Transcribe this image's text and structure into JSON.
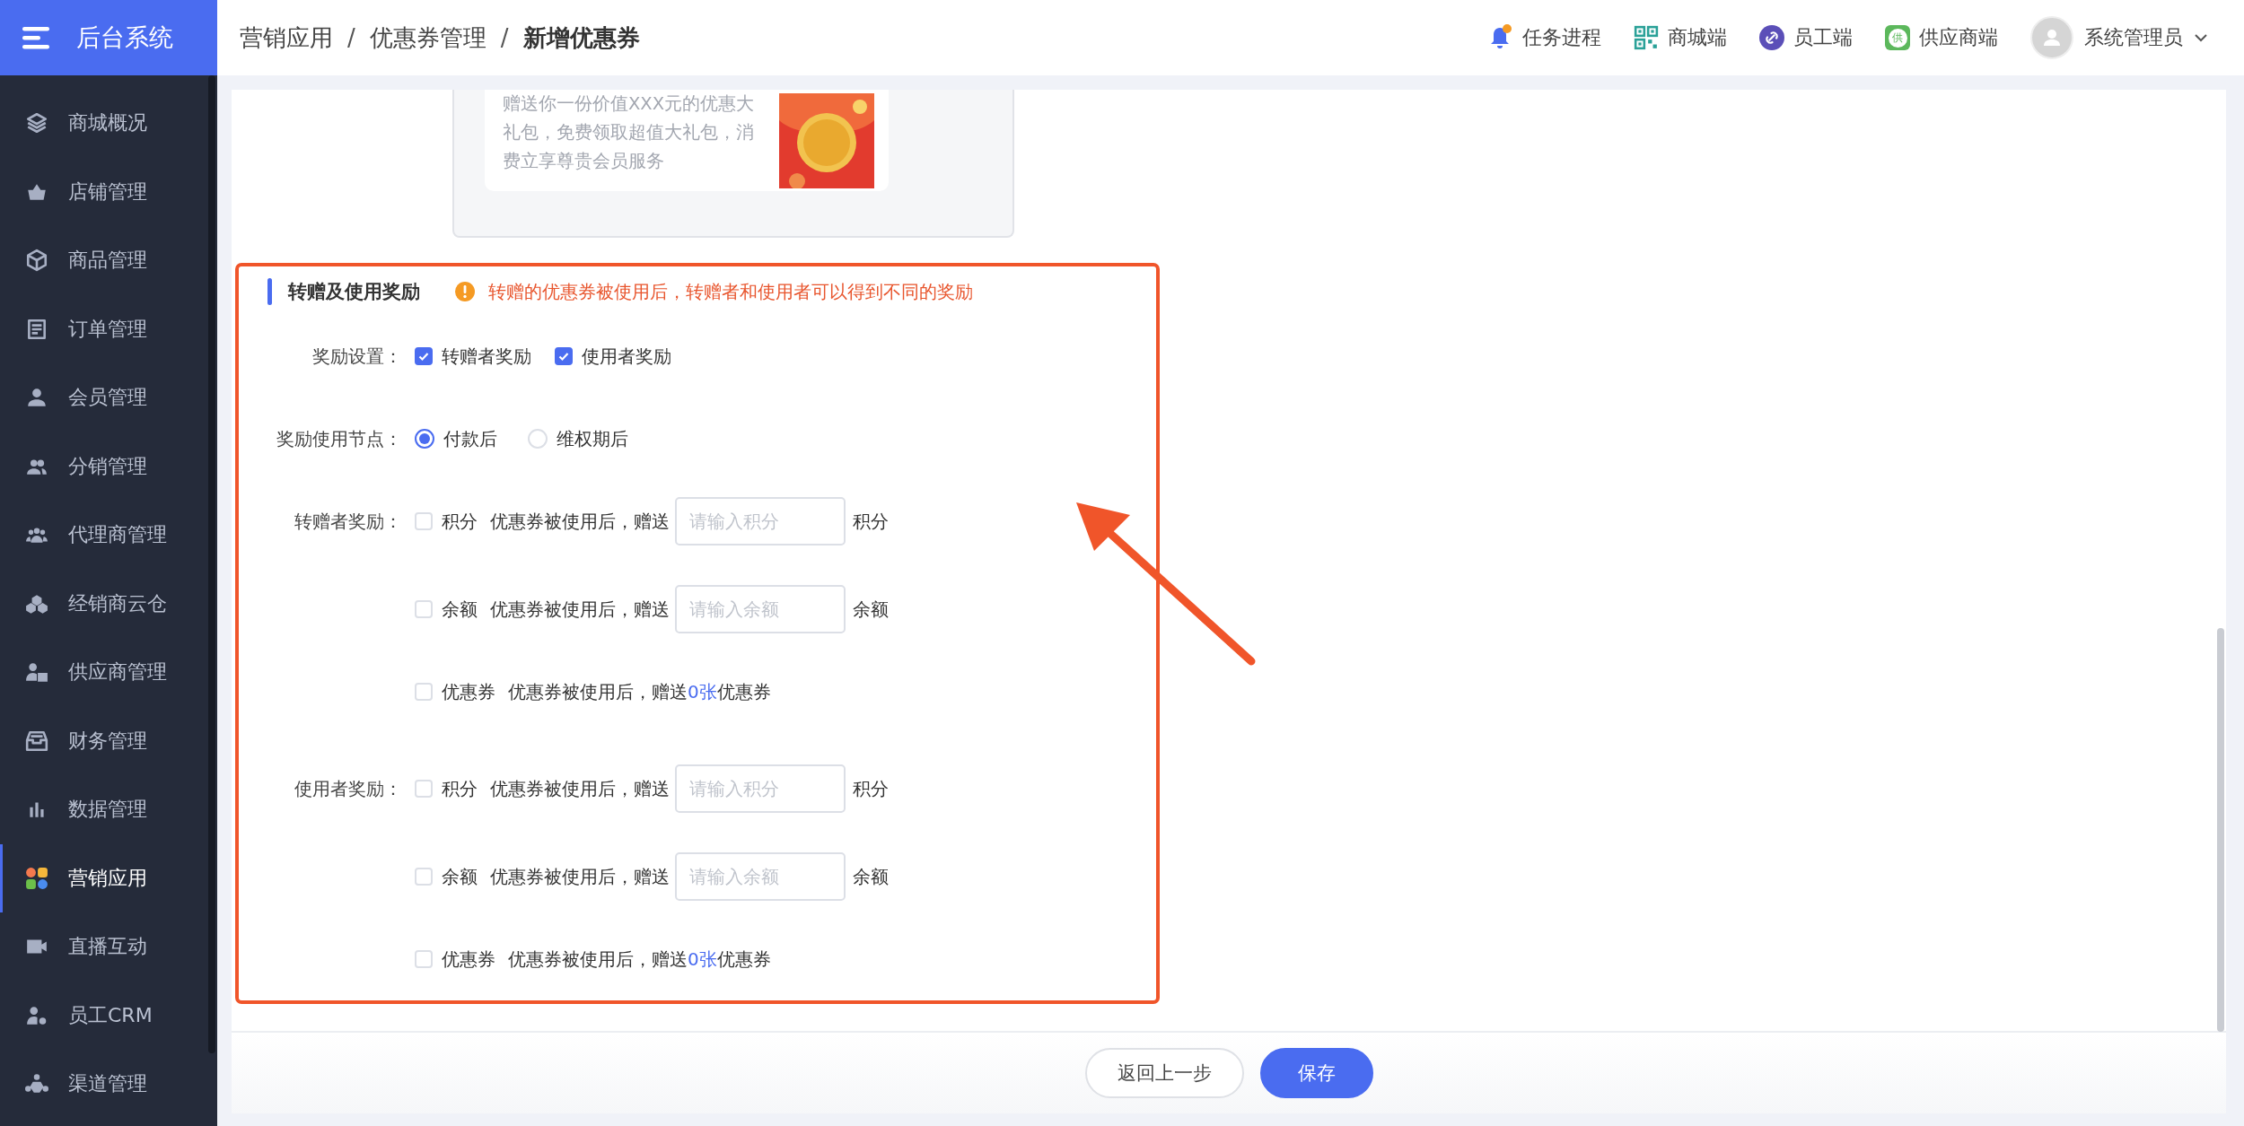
{
  "app": {
    "title": "后台系统"
  },
  "breadcrumb": [
    {
      "label": "营销应用",
      "current": false
    },
    {
      "separator": "/",
      "label": "优惠券管理",
      "current": false
    },
    {
      "separator": "/",
      "label": "新增优惠券",
      "current": true
    }
  ],
  "header_links": [
    {
      "kind": "bell",
      "label": "任务进程",
      "badge": true
    },
    {
      "kind": "qr",
      "label": "商城端"
    },
    {
      "kind": "link",
      "label": "员工端"
    },
    {
      "kind": "supplier",
      "label": "供应商端",
      "icon_text": "供"
    }
  ],
  "user": {
    "name": "系统管理员"
  },
  "sidebar": {
    "items": [
      {
        "kind": "layers",
        "label": "商城概况",
        "selected": false
      },
      {
        "kind": "basket",
        "label": "店铺管理",
        "selected": false
      },
      {
        "kind": "box",
        "label": "商品管理",
        "selected": false
      },
      {
        "kind": "document",
        "label": "订单管理",
        "selected": false
      },
      {
        "kind": "person",
        "label": "会员管理",
        "selected": false
      },
      {
        "kind": "people",
        "label": "分销管理",
        "selected": false
      },
      {
        "kind": "group",
        "label": "代理商管理",
        "selected": false
      },
      {
        "kind": "cubes",
        "label": "经销商云仓",
        "selected": false
      },
      {
        "kind": "badge",
        "label": "供应商管理",
        "selected": false
      },
      {
        "kind": "tray",
        "label": "财务管理",
        "selected": false
      },
      {
        "kind": "chart",
        "label": "数据管理",
        "selected": false
      },
      {
        "kind": "petals",
        "label": "营销应用",
        "selected": true
      },
      {
        "kind": "video",
        "label": "直播互动",
        "selected": false
      },
      {
        "kind": "gear",
        "label": "员工CRM",
        "selected": false
      },
      {
        "kind": "share",
        "label": "渠道管理",
        "selected": false
      }
    ]
  },
  "coupon_preview": {
    "description": "赠送你一份价值XXX元的优惠大礼包，免费领取超值大礼包，消费立享尊贵会员服务"
  },
  "section": {
    "title": "转赠及使用奖励",
    "notice": "转赠的优惠券被使用后，转赠者和使用者可以得到不同的奖励"
  },
  "reward_settings": {
    "label": "奖励设置：",
    "options": [
      {
        "label": "转赠者奖励",
        "checked": true
      },
      {
        "label": "使用者奖励",
        "checked": true
      }
    ]
  },
  "reward_node": {
    "label": "奖励使用节点：",
    "options": [
      {
        "label": "付款后",
        "selected": true
      },
      {
        "label": "维权期后",
        "selected": false
      }
    ]
  },
  "reward_groups": [
    {
      "label": "转赠者奖励：",
      "rows": [
        {
          "kind": "input",
          "checked": false,
          "name": "积分",
          "text": "优惠券被使用后，赠送",
          "placeholder": "请输入积分",
          "unit": "积分"
        },
        {
          "kind": "input",
          "checked": false,
          "name": "余额",
          "text": "优惠券被使用后，赠送",
          "placeholder": "请输入余额",
          "unit": "余额"
        },
        {
          "kind": "coupon",
          "checked": false,
          "name": "优惠券",
          "text": "优惠券被使用后，赠送",
          "count": "0张",
          "unit": "优惠券"
        }
      ]
    },
    {
      "label": "使用者奖励：",
      "rows": [
        {
          "kind": "input",
          "checked": false,
          "name": "积分",
          "text": "优惠券被使用后，赠送",
          "placeholder": "请输入积分",
          "unit": "积分"
        },
        {
          "kind": "input",
          "checked": false,
          "name": "余额",
          "text": "优惠券被使用后，赠送",
          "placeholder": "请输入余额",
          "unit": "余额"
        },
        {
          "kind": "coupon",
          "checked": false,
          "name": "优惠券",
          "text": "优惠券被使用后，赠送",
          "count": "0张",
          "unit": "优惠券"
        }
      ]
    }
  ],
  "footer": {
    "buttons": [
      {
        "kind": "secondary",
        "label": "返回上一步"
      },
      {
        "kind": "primary",
        "label": "保存"
      }
    ]
  }
}
